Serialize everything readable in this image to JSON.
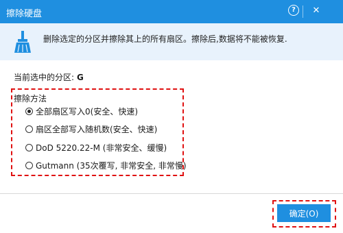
{
  "window": {
    "title": "擦除硬盘",
    "help_label": "?",
    "close_label": "✕",
    "accent_color": "#1f8fe0"
  },
  "banner": {
    "icon": "broom-icon",
    "text": "删除选定的分区并擦除其上的所有扇区。擦除后,数据将不能被恢复."
  },
  "selected_partition": {
    "label": "当前选中的分区:",
    "value": "G"
  },
  "wipe_method": {
    "title": "擦除方法",
    "selected_index": 0,
    "options": [
      "全部扇区写入0(安全、快速)",
      "扇区全部写入随机数(安全、快速)",
      "DoD 5220.22-M (非常安全、缓慢)",
      "Gutmann (35次覆写, 非常安全, 非常慢)"
    ]
  },
  "footer": {
    "ok_label": "确定(O)"
  },
  "highlight_color": "#e01010"
}
